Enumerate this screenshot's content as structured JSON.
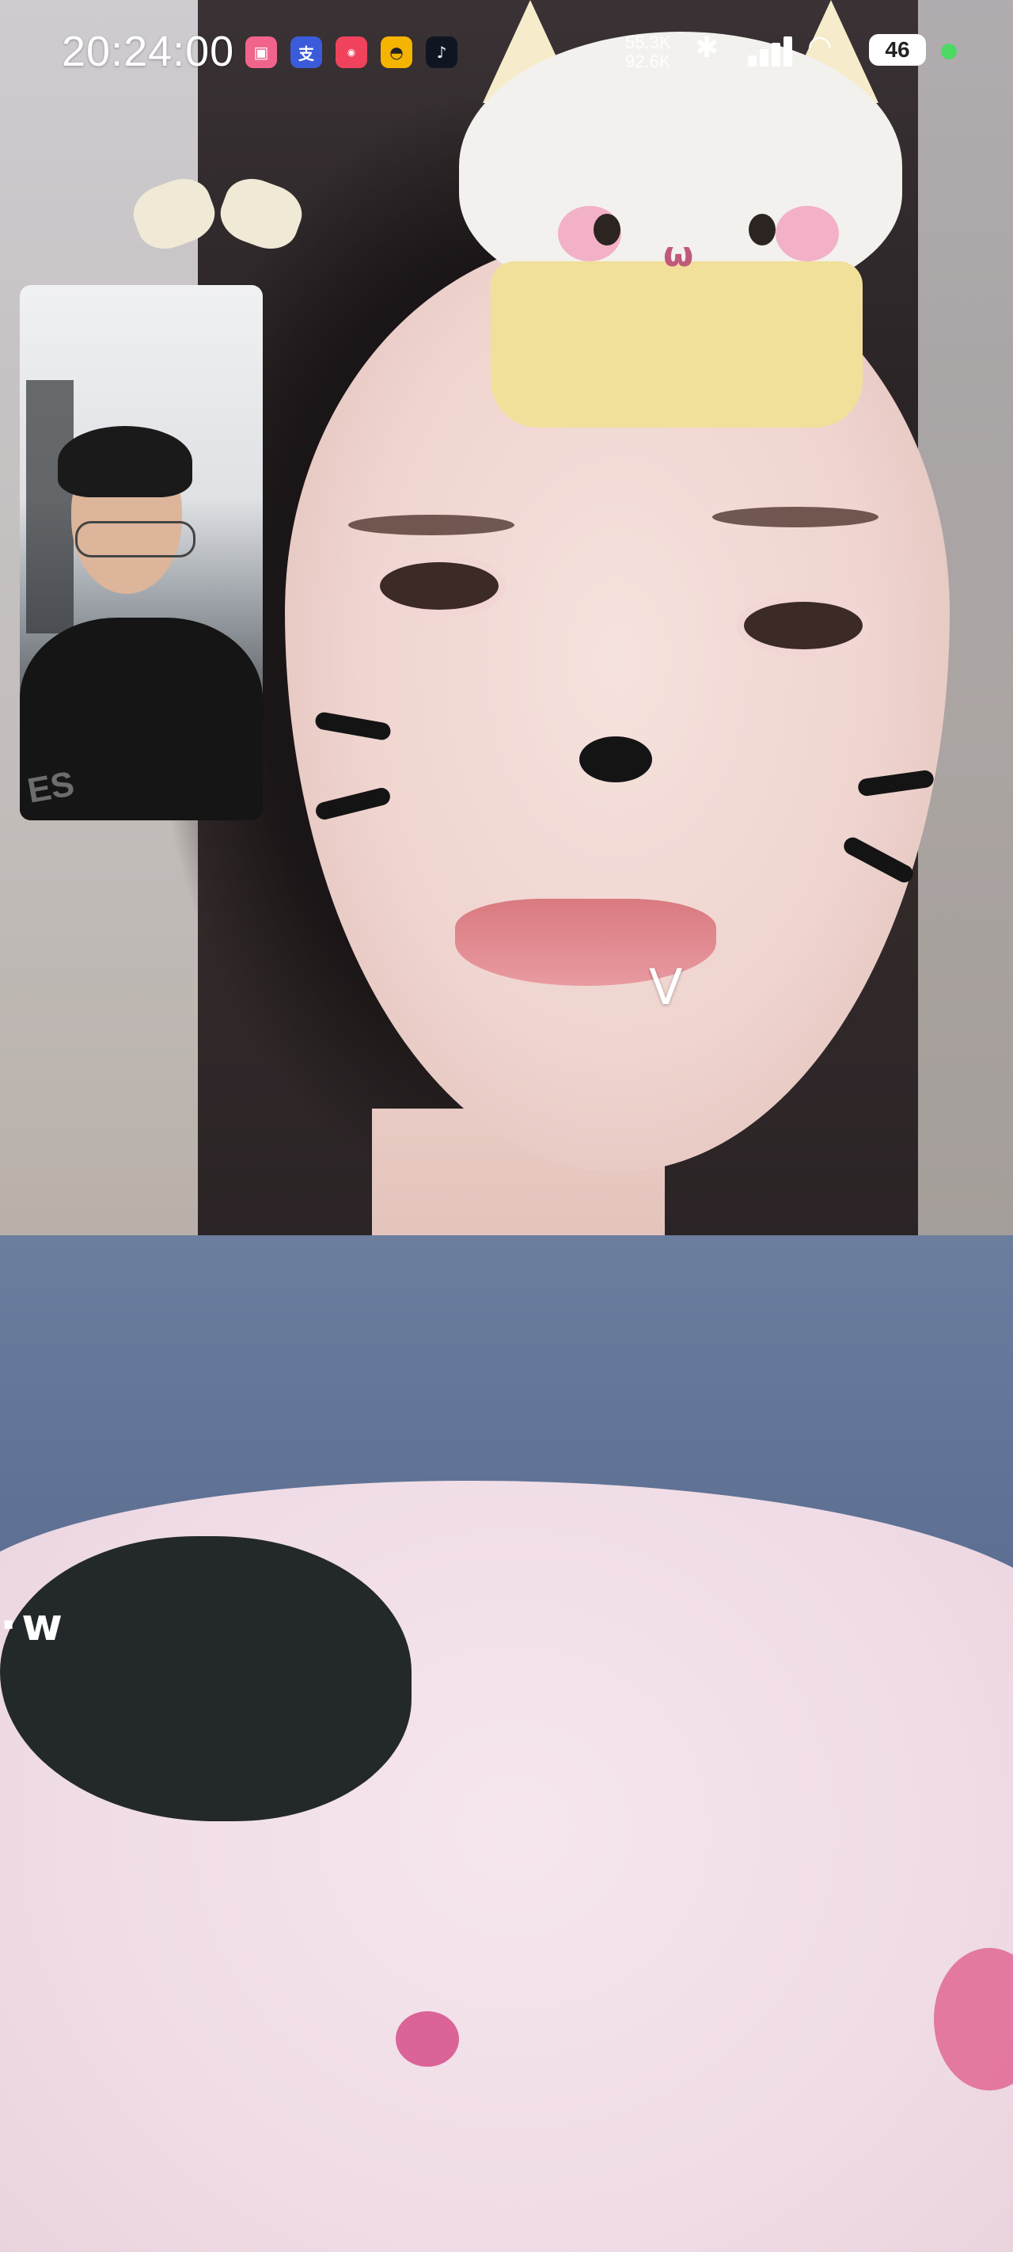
{
  "status_bar": {
    "time": "20:24:00",
    "net_speed_up": "55.3K",
    "net_speed_down": "92.6K",
    "battery": "46",
    "icons": [
      "bilibili-icon",
      "alipay-icon",
      "xiaohongshu-icon",
      "meituan-icon",
      "douyin-icon",
      "bluetooth-icon",
      "signal-icon",
      "wifi-icon",
      "battery-icon",
      "green-indicator-dot"
    ]
  },
  "pip": {
    "shirt_text": "ES"
  },
  "overlay": {
    "v_mark": "V",
    "sticker_text": "·w"
  }
}
